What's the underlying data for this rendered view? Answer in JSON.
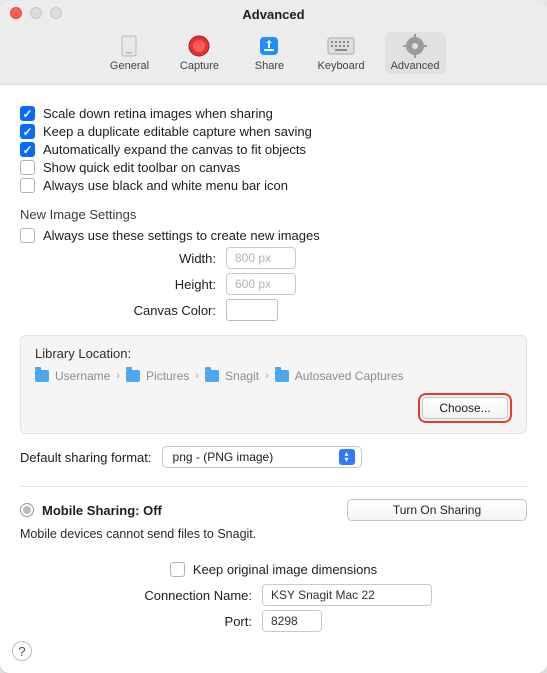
{
  "window": {
    "title": "Advanced"
  },
  "toolbar": {
    "general": "General",
    "capture": "Capture",
    "share": "Share",
    "keyboard": "Keyboard",
    "advanced": "Advanced"
  },
  "checks": {
    "scale_down": "Scale down retina images when sharing",
    "keep_dup": "Keep a duplicate editable capture when saving",
    "auto_expand": "Automatically expand the canvas to fit objects",
    "quick_edit": "Show quick edit toolbar on canvas",
    "bw_menubar": "Always use black and white menu bar icon"
  },
  "new_image": {
    "heading": "New Image Settings",
    "always_use": "Always use these settings to create new images",
    "width_label": "Width:",
    "width_value": "800 px",
    "height_label": "Height:",
    "height_value": "600 px",
    "canvas_color_label": "Canvas Color:"
  },
  "library": {
    "heading": "Library Location:",
    "path": [
      "Username",
      "Pictures",
      "Snagit",
      "Autosaved Captures"
    ],
    "choose": "Choose..."
  },
  "sharing_format": {
    "label": "Default sharing format:",
    "value": "png - (PNG image)"
  },
  "mobile": {
    "title": "Mobile Sharing: Off",
    "turn_on": "Turn On Sharing",
    "note": "Mobile devices cannot send files to Snagit.",
    "keep_dims": "Keep original image dimensions",
    "conn_name_label": "Connection Name:",
    "conn_name_value": "KSY Snagit Mac 22",
    "port_label": "Port:",
    "port_value": "8298"
  },
  "help": "?"
}
